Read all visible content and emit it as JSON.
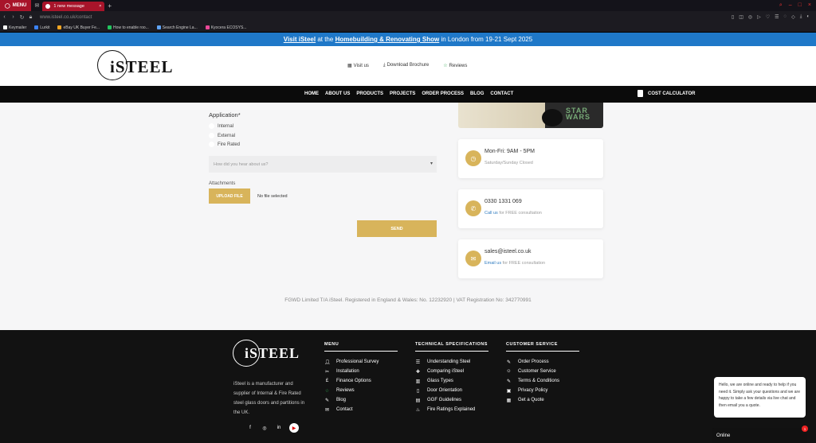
{
  "browser": {
    "menu_label": "MENU",
    "active_tab_title": "1 new message",
    "url": "www.isteel.co.uk/contact",
    "bookmarks": [
      {
        "label": "Keymailer",
        "color": "#ffffff"
      },
      {
        "label": "Lurkit",
        "color": "#3b82f6"
      },
      {
        "label": "eBay UK Buyer Fe...",
        "color": "#f5a623"
      },
      {
        "label": "How to enable roo...",
        "color": "#22c55e"
      },
      {
        "label": "Search Engine La...",
        "color": "#60a5fa"
      },
      {
        "label": "Kyocera ECOSYS...",
        "color": "#ec4899"
      }
    ]
  },
  "promo": {
    "link_text": "Visit iSteel",
    "mid_text": " at the ",
    "event_text": "Homebuilding & Renovating Show",
    "end_text": " in London from 19-21 Sept 2025"
  },
  "header": {
    "logo_text": "STEEL",
    "links": [
      {
        "label": "Visit us",
        "icon": "building-icon"
      },
      {
        "label": "Download Brochure",
        "icon": "download-icon"
      },
      {
        "label": "Reviews",
        "icon": "star-icon"
      }
    ]
  },
  "nav": {
    "items": [
      "HOME",
      "ABOUT US",
      "PRODUCTS",
      "PROJECTS",
      "ORDER PROCESS",
      "BLOG",
      "CONTACT"
    ],
    "calculator": "COST CALCULATOR"
  },
  "form": {
    "application_label": "Application*",
    "options": [
      "Internal",
      "External",
      "Fire Rated"
    ],
    "hear_placeholder": "How did you hear about us?",
    "attachments_label": "Attachments",
    "upload_label": "UPLOAD FILE",
    "no_file": "No file selected",
    "send_label": "SEND"
  },
  "contact_cards": {
    "image_text": "STAR WARS",
    "hours": {
      "title": "Mon-Fri: 9AM - 5PM",
      "sub": "Saturday/Sunday Closed"
    },
    "phone": {
      "title": "0330 1331 069",
      "link": "Call us",
      "sub": " for FREE consultation"
    },
    "email": {
      "title": "sales@isteel.co.uk",
      "link": "Email us",
      "sub": " for FREE consultation"
    }
  },
  "legal": "FGWD Limited T/A iSteel. Registered in England & Wales: No. 12232920 | VAT Registration No: 342770991",
  "footer": {
    "logo_text": "STEEL",
    "about": "iSteel is a manufacturer and supplier of Internal & Fire Rated steel glass doors and partitions in the UK.",
    "menu": {
      "title": "MENU",
      "items": [
        "Professional Survey",
        "Installation",
        "Finance Options",
        "Reviews",
        "Blog",
        "Contact"
      ]
    },
    "tech": {
      "title": "TECHNICAL SPECIFICATIONS",
      "items": [
        "Understanding Steel",
        "Comparing iSteel",
        "Glass Types",
        "Door Orientation",
        "GGF Guidelines",
        "Fire Ratings Explained"
      ]
    },
    "service": {
      "title": "CUSTOMER SERVICE",
      "items": [
        "Order Process",
        "Customer Service",
        "Terms & Conditions",
        "Privacy Policy",
        "Get a Quote"
      ]
    }
  },
  "chat": {
    "message": "Hello, we are online and ready to help if you need it. Simply ask your questions and we are happy to take a few details via live chat and then email you a quote.",
    "status": "Online",
    "badge": "1"
  }
}
